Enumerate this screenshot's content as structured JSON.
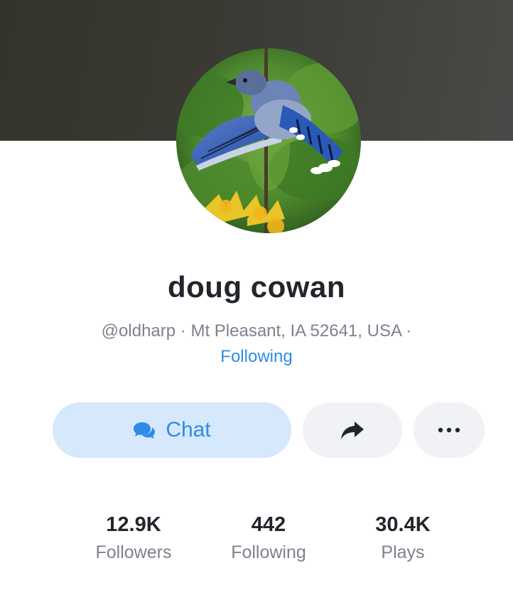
{
  "profile": {
    "name": "doug cowan",
    "handle": "@oldharp",
    "location": "Mt Pleasant, IA 52641, USA",
    "separator": "·",
    "follow_status": "Following"
  },
  "actions": {
    "chat_label": "Chat",
    "chat_icon": "chat-bubbles-icon",
    "share_icon": "share-arrow-icon",
    "more_icon": "ellipsis-icon"
  },
  "stats": [
    {
      "value": "12.9K",
      "label": "Followers"
    },
    {
      "value": "442",
      "label": "Following"
    },
    {
      "value": "30.4K",
      "label": "Plays"
    }
  ],
  "colors": {
    "accent": "#2c8de8",
    "chat_bg": "#d6e8fb",
    "secondary_btn_bg": "#f0f2f5",
    "text_primary": "#22252b",
    "text_secondary": "#7d828c"
  }
}
